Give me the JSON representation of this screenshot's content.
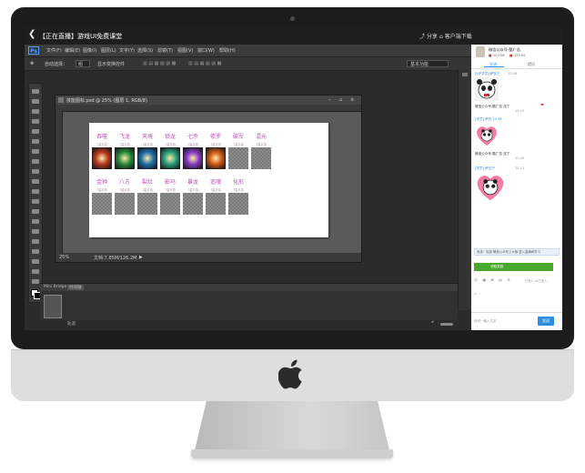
{
  "window": {
    "title": "【正在直播】游戏UI免费课堂",
    "share_label": "分享",
    "client_label": "客户端下载"
  },
  "photoshop": {
    "logo": "Ps",
    "menu": [
      "文件(F)",
      "编辑(E)",
      "图像(I)",
      "图层(L)",
      "文字(Y)",
      "选择(S)",
      "滤镜(T)",
      "视图(V)",
      "窗口(W)",
      "帮助(H)"
    ],
    "options": {
      "auto_select": "自动选择：",
      "group": "组",
      "transform": "显示变换控件"
    },
    "workspace": "基本功能",
    "document_title": "技能图标.psd @ 25% (图层 1, RGB/8)",
    "zoom": "25%",
    "doc_info": "文档:7.85M/126.2M",
    "bridge_tabs": [
      "Mini Bridge",
      "时间轴"
    ],
    "bridge_footer_label": "轨道"
  },
  "canvas": {
    "row1_titles": [
      "吞噬",
      "飞龙",
      "天境",
      "锁龙",
      "七杀",
      "修罗",
      "破军",
      "混元"
    ],
    "row1_subs": [
      "7星手游",
      "7星手游",
      "7星手游",
      "7星手游",
      "7星手游",
      "7星手游",
      "7星手游",
      "7星手游"
    ],
    "row2_titles": [
      "金钟",
      "八方",
      "裂灶",
      "影马",
      "暴龙",
      "追魂",
      "化形"
    ],
    "row2_subs": [
      "7星手游",
      "7星手游",
      "7星手游",
      "7星手游",
      "7星手游",
      "7星手游",
      "7星手游"
    ],
    "icon_colors": [
      "#b83a1e",
      "#2b8c3a",
      "#1f6fa8",
      "#2aa07a",
      "#8a3cc4",
      "#d05a16"
    ]
  },
  "chat": {
    "streamer_name": "微信公众号-酷广告",
    "stat1": "207.5B",
    "stat2": "135.0S",
    "tab_chat": "交流",
    "tab_ask": "提问",
    "messages": [
      {
        "user": "[VIP学员] 萨瓦宁",
        "time": "15:06"
      },
      {
        "user": "微信公众号-酷广告 送了",
        "time": "15:10"
      },
      {
        "user": "[学员] 萨瓦 15:11",
        "time": ""
      },
      {
        "user": "微信公众号-酷广告 送了",
        "time": "15:09"
      },
      {
        "user": "[学员] 萨瓦宁",
        "time": "15:11"
      }
    ],
    "banner": "系统：欢迎 微信公众号上大咖 进入直播间学习",
    "green_button": "领取奖励",
    "online_text": "已有1.1k已进入",
    "input_placeholder": "你好~输入文字",
    "send_label": "发送"
  }
}
